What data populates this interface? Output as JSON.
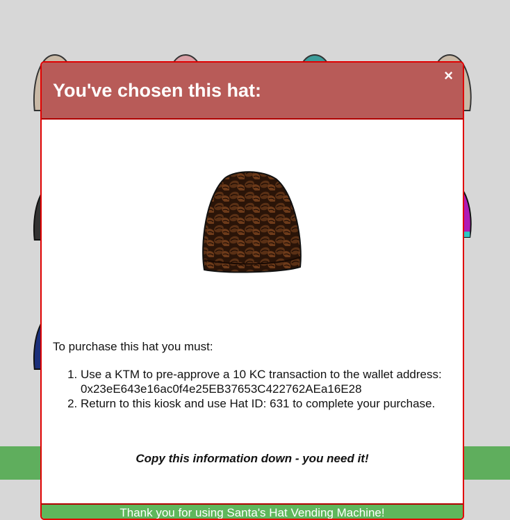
{
  "background_hats": [
    {
      "name": "beige-knit-hat",
      "color": "#c9b9a6"
    },
    {
      "name": "pink-knit-hat",
      "color": "#d89fa5"
    },
    {
      "name": "teal-knit-hat",
      "color": "#3c9c99"
    },
    {
      "name": "beige-knit-hat-2",
      "color": "#c9b9a6"
    },
    {
      "name": "dark-knit-hat",
      "color": "#333333"
    },
    {
      "name": "magenta-knit-hat",
      "color": "#b01ab5"
    },
    {
      "name": "navy-knit-hat",
      "color": "#1b2f7a"
    }
  ],
  "modal": {
    "title": "You've chosen this hat:",
    "close_icon": "×",
    "hat_image": "coffee-bean-knit-hat",
    "intro": "To purchase this hat you must:",
    "steps": [
      "Use a KTM to pre-approve a 10 KC transaction to the wallet address: 0x23eE643e16ac0f4e25EB37653C422762AEa16E28",
      "Return to this kiosk and use Hat ID: 631 to complete your purchase."
    ],
    "copy_note": "Copy this information down - you need it!",
    "footer": "Thank you for using Santa's Hat Vending Machine!"
  },
  "colors": {
    "modal_header": "#b85b58",
    "modal_border": "#e00000",
    "green_bar": "#5fae5d",
    "footer": "#5fb75c"
  }
}
